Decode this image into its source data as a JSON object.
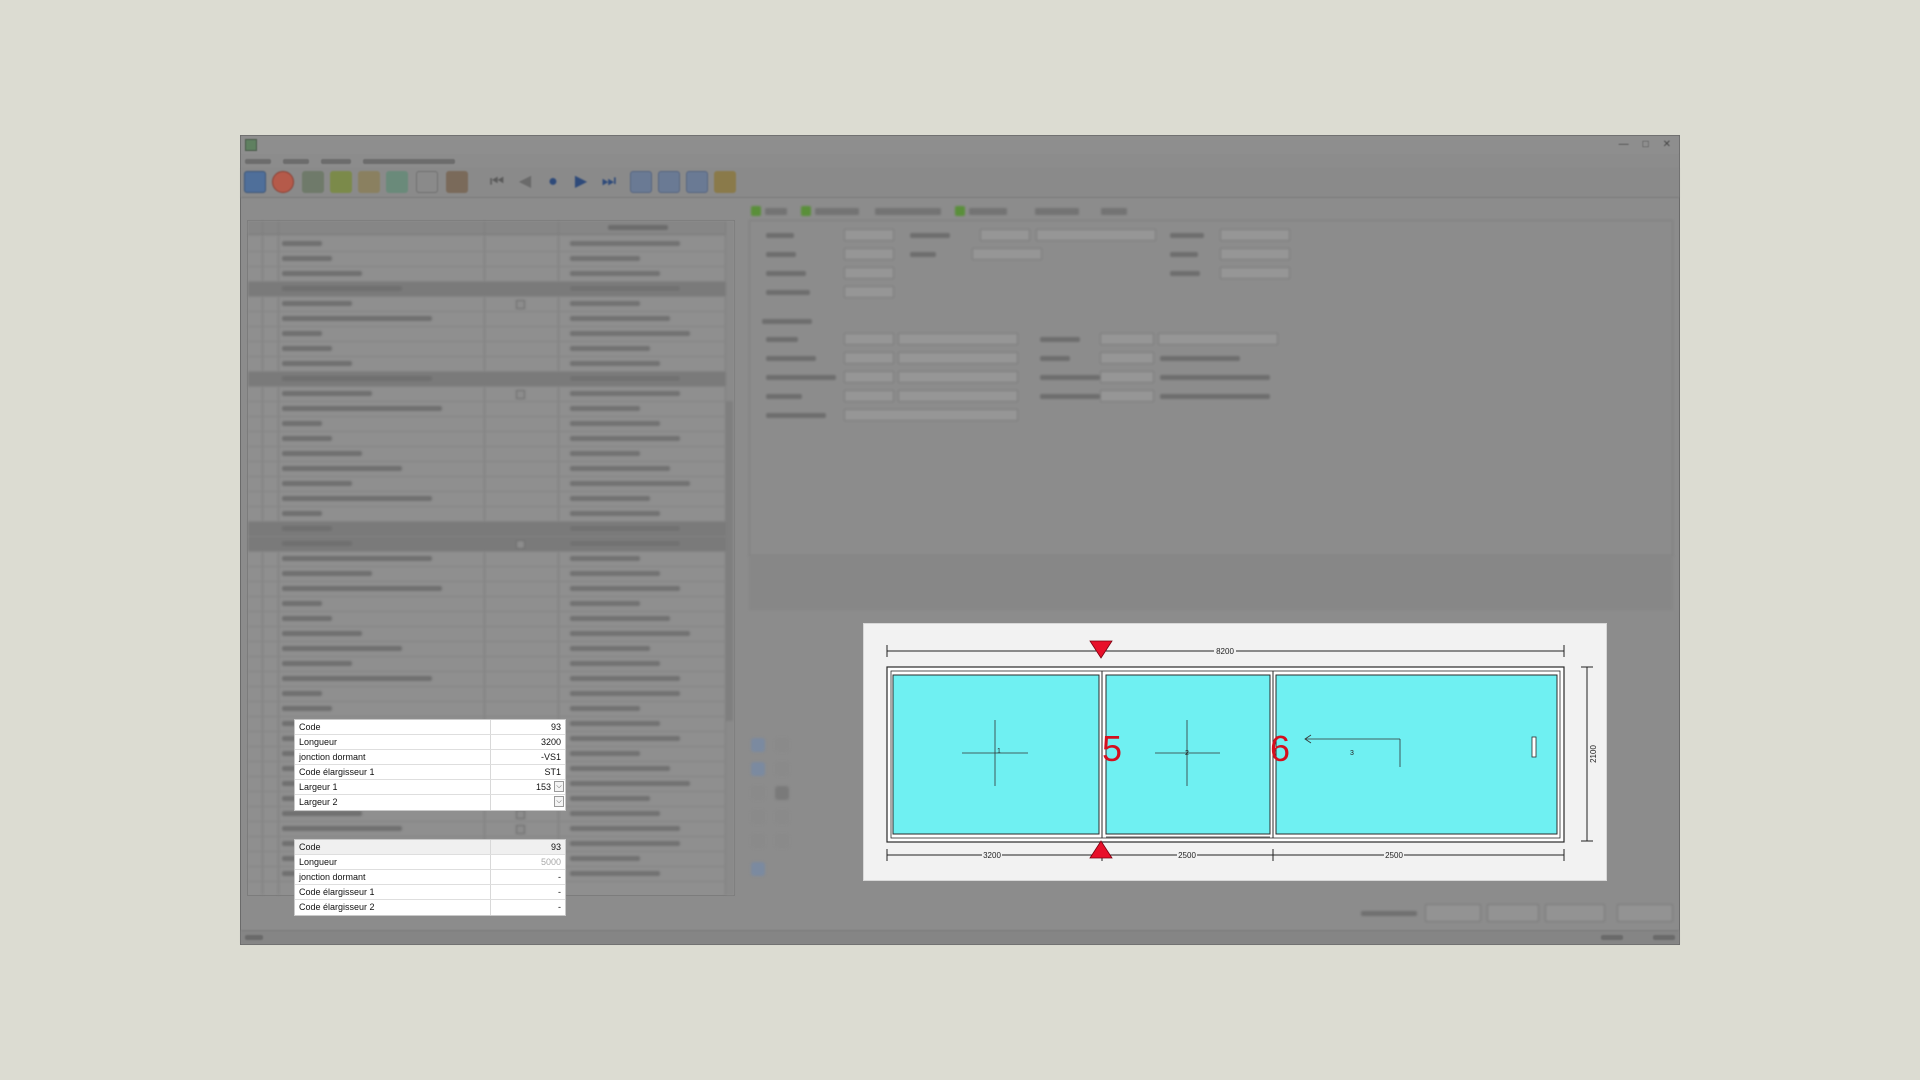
{
  "window": {
    "title": ""
  },
  "focused_table_1": {
    "rows": [
      {
        "label": "Code",
        "value": "93",
        "has_dropdown": false,
        "muted": false
      },
      {
        "label": "Longueur",
        "value": "3200",
        "has_dropdown": false,
        "muted": false
      },
      {
        "label": "jonction dormant",
        "value": "-VS1",
        "has_dropdown": false,
        "muted": false
      },
      {
        "label": "Code élargisseur 1",
        "value": "ST1",
        "has_dropdown": false,
        "muted": false
      },
      {
        "label": "Largeur 1",
        "value": "153",
        "has_dropdown": true,
        "muted": false
      },
      {
        "label": "Largeur 2",
        "value": "",
        "has_dropdown": true,
        "muted": false
      }
    ]
  },
  "focused_table_2": {
    "rows": [
      {
        "label": "Code",
        "value": "93",
        "muted": false
      },
      {
        "label": "Longueur",
        "value": "5000",
        "muted": true
      },
      {
        "label": "jonction dormant",
        "value": "-",
        "muted": false
      },
      {
        "label": "Code élargisseur 1",
        "value": "-",
        "muted": false
      },
      {
        "label": "Code élargisseur 2",
        "value": "-",
        "muted": false
      }
    ]
  },
  "drawing": {
    "total_width": "8200",
    "height": "2100",
    "segment_widths": [
      "3200",
      "2500",
      "2500"
    ],
    "panel_numbers": [
      "1",
      "2",
      "3"
    ],
    "annotation_markers": [
      "5",
      "6"
    ],
    "colors": {
      "glass": "#6ff0f2",
      "marker_red": "#e8102a",
      "annotation_red": "#d40f1e",
      "frame": "#2a2a2a"
    }
  },
  "icons": [
    "app-icon",
    "home-icon",
    "stop-icon",
    "first-record-icon",
    "previous-record-icon",
    "current-record-icon",
    "next-record-icon",
    "last-record-icon",
    "split-marker-top-icon",
    "split-marker-bottom-icon",
    "tab-check-icon",
    "dropdown-arrow-icon",
    "opening-direction-arrow-icon"
  ]
}
